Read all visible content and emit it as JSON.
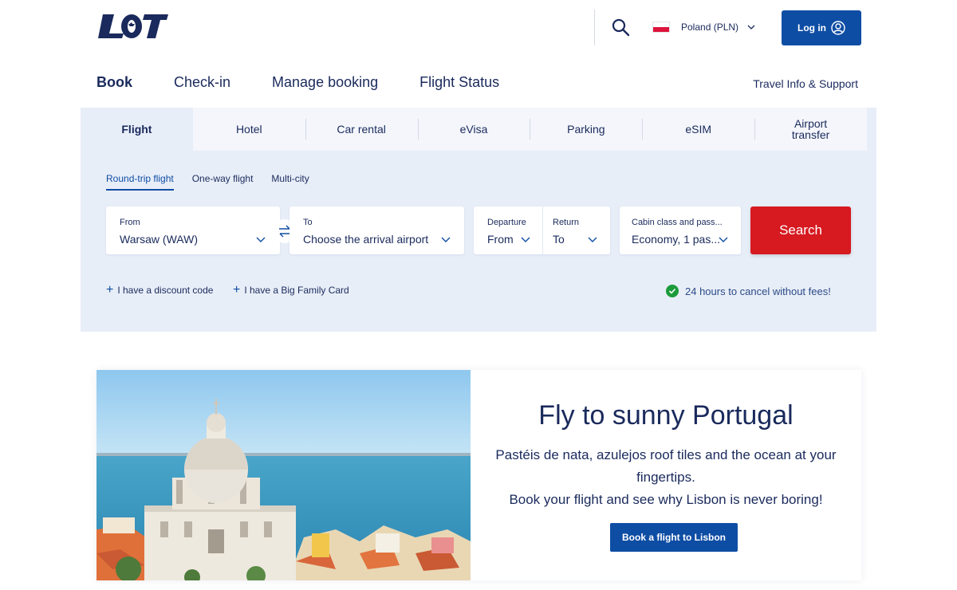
{
  "brand": {
    "logo_text": "LOT",
    "primary": "#0e4da4",
    "navy": "#1a2a5c",
    "cta_red": "#d71920",
    "panel_bg": "#e8eef8"
  },
  "header": {
    "language": "Poland (PLN)",
    "login_label": "Log in"
  },
  "main_nav": {
    "items": [
      "Book",
      "Check-in",
      "Manage booking",
      "Flight Status"
    ],
    "support": "Travel Info & Support"
  },
  "booking": {
    "tabs": [
      "Flight",
      "Hotel",
      "Car rental",
      "eVisa",
      "Parking",
      "eSIM",
      "Airport transfer"
    ],
    "trip_types": [
      "Round-trip flight",
      "One-way flight",
      "Multi-city"
    ],
    "from": {
      "label": "From",
      "value": "Warsaw (WAW)"
    },
    "to": {
      "label": "To",
      "placeholder": "Choose the arrival airport"
    },
    "departure": {
      "label": "Departure",
      "placeholder": "From"
    },
    "return": {
      "label": "Return",
      "placeholder": "To"
    },
    "cabin": {
      "label": "Cabin class and pass...",
      "value": "Economy, 1 pas..."
    },
    "search_label": "Search",
    "discount_code": "I have a discount code",
    "family_card": "I have a Big Family Card",
    "cancel_info": "24 hours to cancel without fees!"
  },
  "promo": {
    "title": "Fly to sunny Portugal",
    "line1": "Pastéis de nata, azulejos roof tiles and the ocean at your fingertips.",
    "line2": "Book your flight and see why Lisbon is never boring!",
    "button": "Book a flight to Lisbon"
  }
}
